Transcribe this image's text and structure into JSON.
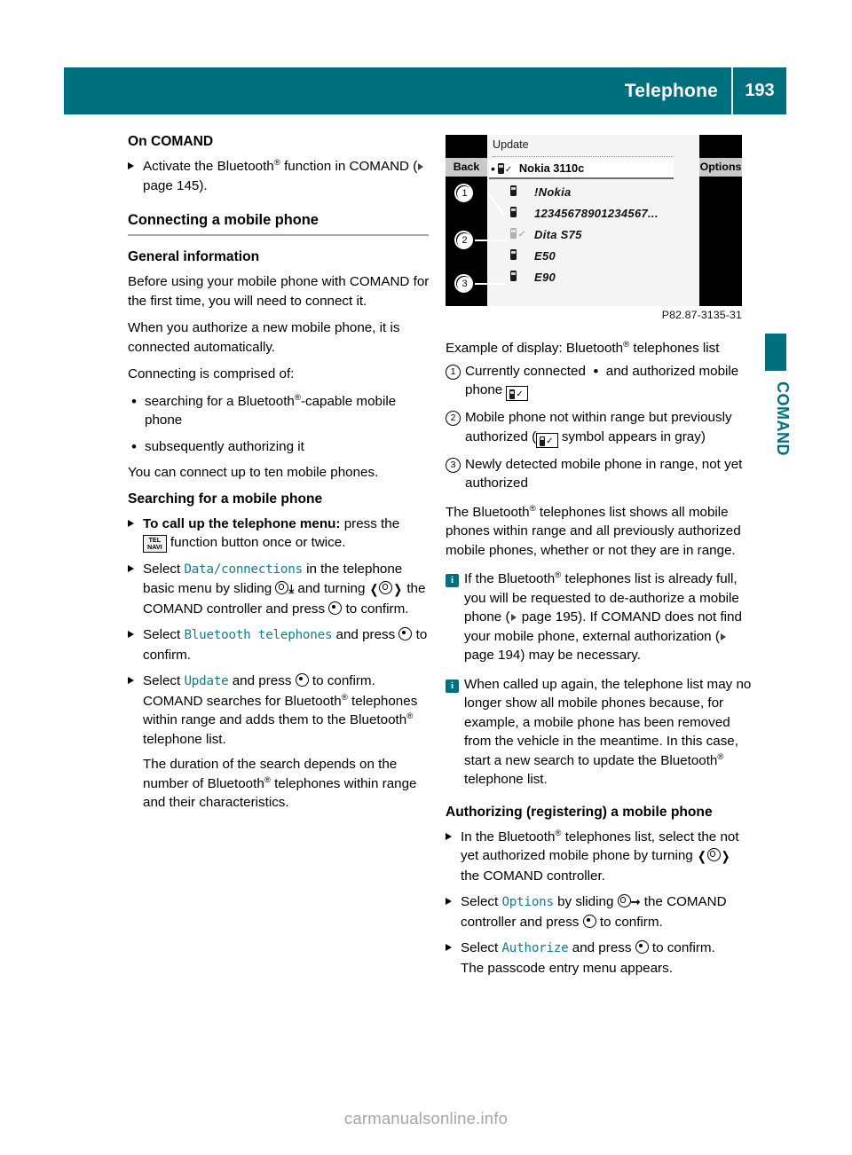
{
  "header": {
    "title": "Telephone",
    "page_number": "193"
  },
  "side_tab": {
    "label": "COMAND"
  },
  "watermark": "carmanualsonline.info",
  "figure": {
    "code": "P82.87-3135-31",
    "screen": {
      "title": "Update",
      "back_button": "Back",
      "options_button": "Options",
      "selected_entry": "Nokia 3110c",
      "items": [
        {
          "name": "!Nokia",
          "state": "black"
        },
        {
          "name": "12345678901234567...",
          "state": "black"
        },
        {
          "name": "Dita S75",
          "state": "gray-check"
        },
        {
          "name": "E50",
          "state": "black"
        },
        {
          "name": "E90",
          "state": "black"
        }
      ]
    },
    "callouts": [
      "1",
      "2",
      "3"
    ]
  },
  "left_column": {
    "h_on_comand": "On COMAND",
    "step_activate_a": "Activate the Bluetooth",
    "step_activate_b": " function in COMAND (",
    "step_activate_page": " page 145).",
    "h_connecting": "Connecting a mobile phone",
    "h_general_info": "General information",
    "p_before_using": "Before using your mobile phone with COMAND for the first time, you will need to connect it.",
    "p_when_authorize": "When you authorize a new mobile phone, it is connected automatically.",
    "p_comprised": "Connecting is comprised of:",
    "bullet_searching_a": "searching for a Bluetooth",
    "bullet_searching_b": "-capable mobile phone",
    "bullet_subsequently": "subsequently authorizing it",
    "p_up_to_ten": "You can connect up to ten mobile phones.",
    "h_searching": "Searching for a mobile phone",
    "step_callup_bold": "To call up the telephone menu:",
    "step_callup_a": " press the",
    "step_callup_b": " function button once or twice.",
    "telnavi_line1": "TEL",
    "telnavi_line2": "NAVI",
    "step_select_data_a": "Select",
    "step_select_data_code": "Data/connections",
    "step_select_data_b": " in the telephone basic menu by sliding",
    "step_select_data_c": " and turning",
    "step_select_data_d": " the COMAND controller and press",
    "step_select_data_e": " to confirm.",
    "step_select_bt_a": "Select",
    "step_select_bt_code": "Bluetooth telephones",
    "step_select_bt_b": " and press",
    "step_select_bt_c": " to confirm.",
    "step_select_update_a": "Select",
    "step_select_update_code": "Update",
    "step_select_update_b": " and press",
    "step_select_update_c": " to confirm.",
    "step_update_body_a": "COMAND searches for Bluetooth",
    "step_update_body_b": " telephones within range and adds them to the Bluetooth",
    "step_update_body_c": " telephone list.",
    "p_duration_a": "The duration of the search depends on the number of Bluetooth",
    "p_duration_b": " telephones within range and their characteristics."
  },
  "right_column": {
    "caption_a": "Example of display: Bluetooth",
    "caption_b": " telephones list",
    "legend": [
      {
        "num": "1",
        "text_a": "Currently connected",
        "text_b": "and authorized mobile phone"
      },
      {
        "num": "2",
        "text_a": "Mobile phone not within range but previously authorized (",
        "text_b": " symbol appears in gray)"
      },
      {
        "num": "3",
        "text_a": "Newly detected mobile phone in range, not yet authorized",
        "text_b": ""
      }
    ],
    "p_list_shows_a": "The Bluetooth",
    "p_list_shows_b": " telephones list shows all mobile phones within range and all previously authorized mobile phones, whether or not they are in range.",
    "note1_a": "If the Bluetooth",
    "note1_b": " telephones list is already full, you will be requested to de-authorize a mobile phone (",
    "note1_page1": " page 195). If COMAND does not find your mobile phone, external authorization (",
    "note1_page2": " page 194) may be necessary.",
    "note2_a": "When called up again, the telephone list may no longer show all mobile phones because, for example, a mobile phone has been removed from the vehicle in the meantime. In this case, start a new search to update the Bluetooth",
    "note2_b": " telephone list.",
    "h_authorizing": "Authorizing (registering) a mobile phone",
    "step_in_bt_a": "In the Bluetooth",
    "step_in_bt_b": " telephones list, select the not yet authorized mobile phone by turning",
    "step_in_bt_c": " the COMAND controller.",
    "step_options_a": "Select",
    "step_options_code": "Options",
    "step_options_b": " by sliding",
    "step_options_c": " the COMAND controller and press",
    "step_options_d": " to confirm.",
    "step_authorize_a": "Select",
    "step_authorize_code": "Authorize",
    "step_authorize_b": " and press",
    "step_authorize_c": " to confirm.",
    "step_authorize_d": "The passcode entry menu appears."
  }
}
